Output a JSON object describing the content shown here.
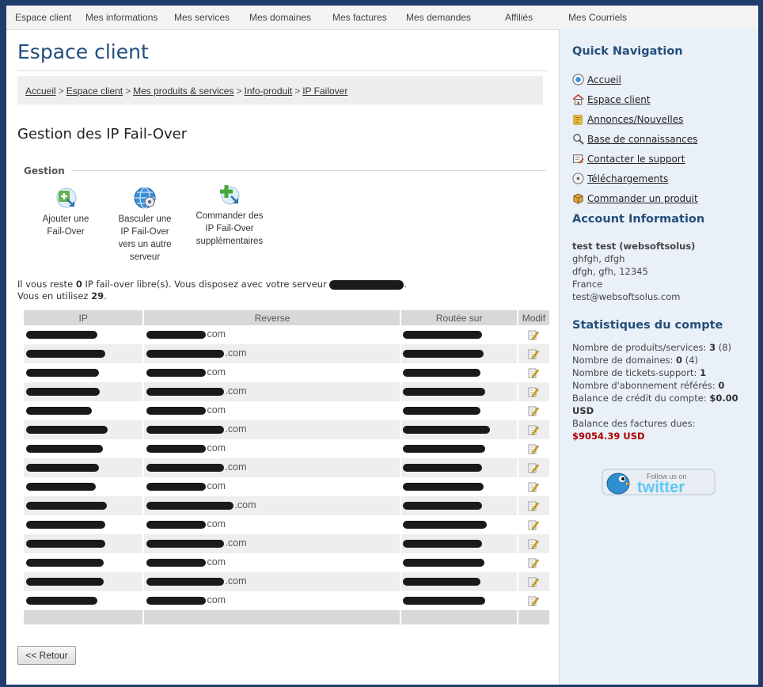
{
  "nav": [
    {
      "label": "Espace client"
    },
    {
      "label": "Mes informations"
    },
    {
      "label": "Mes services"
    },
    {
      "label": "Mes domaines"
    },
    {
      "label": "Mes factures"
    },
    {
      "label": "Mes demandes"
    },
    {
      "label": "Affiliés"
    },
    {
      "label": "Mes Courriels"
    }
  ],
  "page_title": "Espace client",
  "breadcrumb": {
    "items": [
      "Accueil",
      "Espace client",
      "Mes produits & services",
      "Info-produit",
      "IP Failover"
    ],
    "separator": ">"
  },
  "section_title": "Gestion des IP Fail-Over",
  "gestion": {
    "legend": "Gestion",
    "actions": [
      {
        "line1": "Ajouter une",
        "line2": "Fail-Over",
        "line3": "",
        "line4": "",
        "icon": "add-failover-icon"
      },
      {
        "line1": "Basculer une",
        "line2": "IP Fail-Over",
        "line3": "vers un autre",
        "line4": "serveur",
        "icon": "switch-globe-icon"
      },
      {
        "line1": "Commander des",
        "line2": "IP Fail-Over",
        "line3": "supplémentaires",
        "line4": "",
        "icon": "order-plus-icon"
      }
    ]
  },
  "info": {
    "line1_prefix": "Il vous reste ",
    "free_count": "0",
    "line1_suffix": " IP fail-over libre(s). Vous disposez avec votre serveur ",
    "line2_prefix": "Vous en utilisez ",
    "used_count": "29",
    "line2_suffix": "."
  },
  "table": {
    "headers": [
      "IP",
      "Reverse",
      "Routée sur",
      "Modif"
    ],
    "rows": [
      {
        "reverse": "com"
      },
      {
        "reverse": ".com"
      },
      {
        "reverse": "com"
      },
      {
        "reverse": ".com"
      },
      {
        "reverse": "com"
      },
      {
        "reverse": ".com"
      },
      {
        "reverse": "com"
      },
      {
        "reverse": ".com"
      },
      {
        "reverse": "com"
      },
      {
        "reverse": ".com"
      },
      {
        "reverse": "com"
      },
      {
        "reverse": ".com"
      },
      {
        "reverse": "com"
      },
      {
        "reverse": ".com"
      },
      {
        "reverse": "com"
      }
    ]
  },
  "back_button": "<< Retour",
  "sidebar": {
    "quick_nav_title": "Quick Navigation",
    "quick_nav": [
      {
        "label": "Accueil",
        "icon": "home-globe-icon"
      },
      {
        "label": "Espace client",
        "icon": "house-icon"
      },
      {
        "label": "Annonces/Nouvelles",
        "icon": "news-icon"
      },
      {
        "label": "Base de connaissances",
        "icon": "magnifier-icon"
      },
      {
        "label": "Contacter le support",
        "icon": "support-icon"
      },
      {
        "label": "Téléchargements",
        "icon": "download-icon"
      },
      {
        "label": "Commander un produit",
        "icon": "box-icon"
      }
    ],
    "account_title": "Account Information",
    "account": {
      "name": "test test (websoftsolus)",
      "line1": "ghfgh, dfgh",
      "line2": "dfgh, gfh, 12345",
      "country": "France",
      "email": "test@websoftsolus.com"
    },
    "stats_title": "Statistiques du compte",
    "stats": {
      "products_label": "Nombre de produits/services: ",
      "products_value": "3",
      "products_extra": " (8)",
      "domains_label": "Nombre de domaines: ",
      "domains_value": "0",
      "domains_extra": " (4)",
      "tickets_label": "Nombre de tickets-support: ",
      "tickets_value": "1",
      "referrals_label": "Nombre d'abonnement référés: ",
      "referrals_value": "0",
      "credit_label": "Balance de crédit du compte: ",
      "credit_value": "$0.00",
      "credit_currency": "USD",
      "due_label": "Balance des factures dues:",
      "due_value": "$9054.39 USD"
    },
    "twitter": {
      "line1": "Follow us on",
      "line2": "twitter"
    }
  },
  "colors": {
    "accent": "#244f7b",
    "sidebar_bg": "#e9f0f8",
    "due": "#b00000",
    "frame": "#1f3c6b"
  }
}
